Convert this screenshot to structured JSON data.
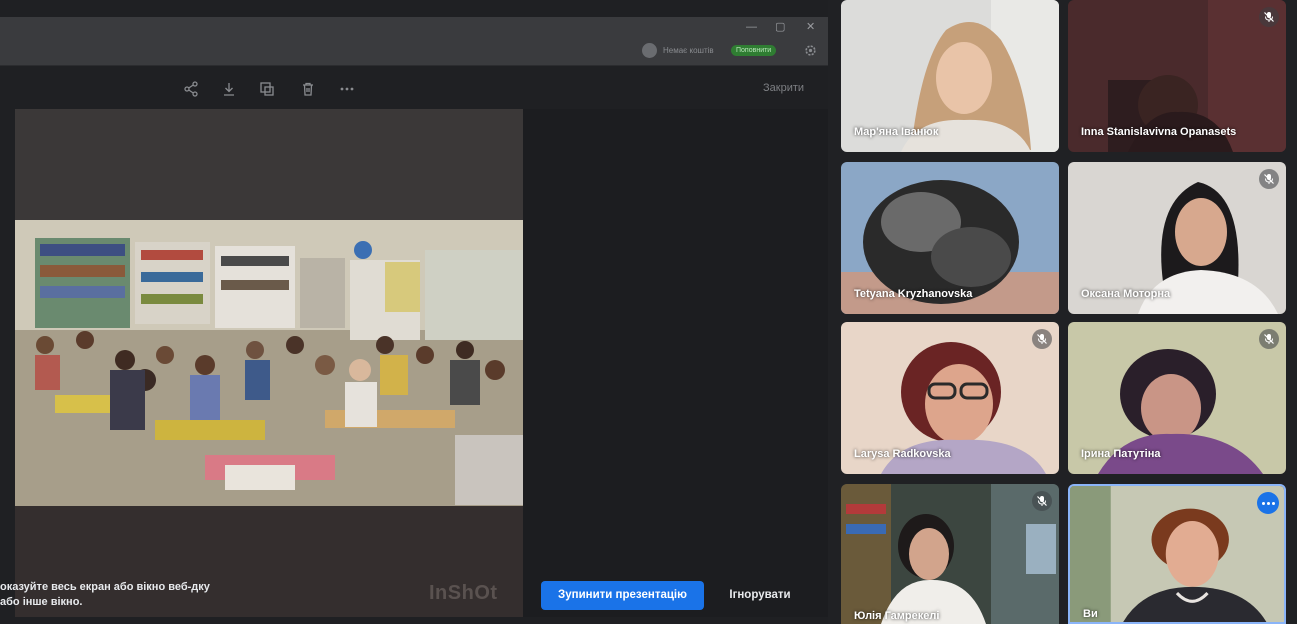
{
  "window": {
    "minimize_glyph": "—",
    "maximize_glyph": "▢",
    "close_glyph": "✕",
    "wallet_text": "Немає коштів",
    "refill_label": "Поповнити"
  },
  "toolbar": {
    "icons": [
      "share-icon",
      "download-icon",
      "rotate-icon",
      "trash-icon",
      "more-icon"
    ],
    "close_label": "Закрити"
  },
  "photo": {
    "watermark": "InShOt"
  },
  "share_banner": {
    "message": "оказуйте весь екран або вікно веб-дку або інше вікно.",
    "stop_label": "Зупинити презентацію",
    "ignore_label": "Ігнорувати"
  },
  "participants": [
    {
      "name": "Мар'яна Іванюк",
      "muted": false
    },
    {
      "name": "Inna Stanislavivna Opanasets",
      "muted": true
    },
    {
      "name": "Tetyana Kryzhanovska",
      "muted": false
    },
    {
      "name": "Оксана Моторна",
      "muted": true
    },
    {
      "name": "Larysa Radkovska",
      "muted": true
    },
    {
      "name": "Ірина Патутіна",
      "muted": true
    },
    {
      "name": "Юлія Гамрекелі",
      "muted": true
    },
    {
      "name": "Ви",
      "muted": false,
      "active_speaker": true
    }
  ],
  "colors": {
    "background": "#202124",
    "accent_blue": "#1a73e8",
    "speaker_border": "#8ab4f8"
  }
}
